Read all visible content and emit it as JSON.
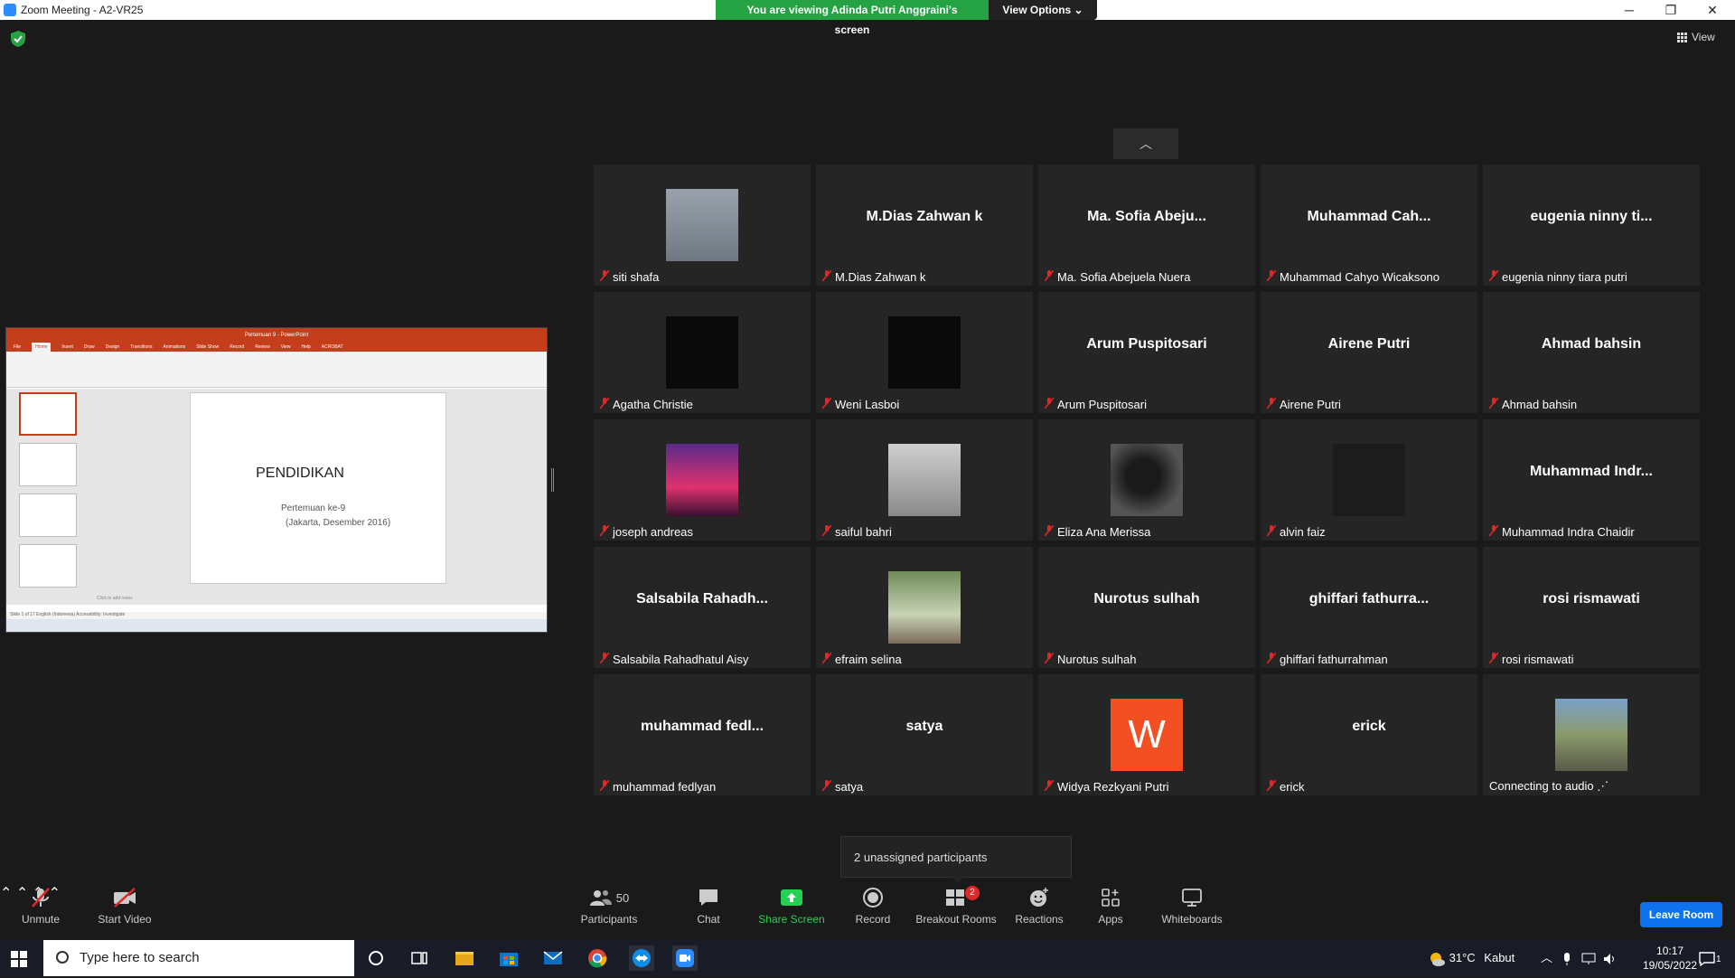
{
  "window": {
    "title": "Zoom Meeting - A2-VR25",
    "minimize": "─",
    "maximize": "❐",
    "close": "✕"
  },
  "banner": {
    "viewing": "You are viewing Adinda Putri Anggraini's screen",
    "view_options": "View Options ⌄"
  },
  "view_button": "View",
  "shared_screen": {
    "app_title": "Pertemuan 9 - PowerPoint",
    "tabs": [
      "File",
      "Home",
      "Insert",
      "Draw",
      "Design",
      "Transitions",
      "Animations",
      "Slide Show",
      "Record",
      "Review",
      "View",
      "Help",
      "ACROBAT"
    ],
    "slide_title": "PENDIDIKAN",
    "slide_line1": "Pertemuan ke-9",
    "slide_line2": "(Jakarta, Desember 2016)",
    "notes": "Click to add notes",
    "status": "Slide 1 of 17   English (Indonesia)   Accessibility: Investigate"
  },
  "participants_grid": [
    {
      "big": "",
      "name": "siti shafa",
      "video": "grey"
    },
    {
      "big": "M.Dias Zahwan k",
      "name": "M.Dias Zahwan k",
      "video": ""
    },
    {
      "big": "Ma. Sofia Abeju...",
      "name": "Ma. Sofia Abejuela Nuera",
      "video": ""
    },
    {
      "big": "Muhammad Cah...",
      "name": "Muhammad Cahyo Wicaksono",
      "video": ""
    },
    {
      "big": "eugenia ninny ti...",
      "name": "eugenia ninny tiara putri",
      "video": ""
    },
    {
      "big": "",
      "name": "Agatha Christie",
      "video": "black"
    },
    {
      "big": "",
      "name": "Weni Lasboi",
      "video": "black"
    },
    {
      "big": "Arum Puspitosari",
      "name": "Arum Puspitosari",
      "video": ""
    },
    {
      "big": "Airene Putri",
      "name": "Airene Putri",
      "video": ""
    },
    {
      "big": "Ahmad bahsin",
      "name": "Ahmad bahsin",
      "video": ""
    },
    {
      "big": "",
      "name": "joseph andreas",
      "video": "sunset"
    },
    {
      "big": "",
      "name": "saiful bahri",
      "video": "person"
    },
    {
      "big": "",
      "name": "Eliza Ana Merissa",
      "video": "silhouette"
    },
    {
      "big": "",
      "name": "alvin faiz",
      "video": "dark"
    },
    {
      "big": "Muhammad Indr...",
      "name": "Muhammad Indra Chaidir",
      "video": ""
    },
    {
      "big": "Salsabila Rahadh...",
      "name": "Salsabila Rahadhatul Aisy",
      "video": ""
    },
    {
      "big": "",
      "name": "efraim selina",
      "video": "plants"
    },
    {
      "big": "Nurotus sulhah",
      "name": "Nurotus sulhah",
      "video": ""
    },
    {
      "big": "ghiffari fathurra...",
      "name": "ghiffari fathurrahman",
      "video": ""
    },
    {
      "big": "rosi rismawati",
      "name": "rosi rismawati",
      "video": ""
    },
    {
      "big": "muhammad fedl...",
      "name": "muhammad fedlyan",
      "video": ""
    },
    {
      "big": "satya",
      "name": "satya",
      "video": ""
    },
    {
      "big": "",
      "name": "Widya Rezkyani Putri",
      "video": "letter",
      "letter": "W"
    },
    {
      "big": "erick",
      "name": "erick",
      "video": ""
    },
    {
      "big": "",
      "name": "Connecting to audio ⋰",
      "video": "bike",
      "no_mic": true
    }
  ],
  "popup": "2 unassigned participants",
  "toolbar": {
    "unmute": "Unmute",
    "start_video": "Start Video",
    "participants": "Participants",
    "participants_count": "50",
    "chat": "Chat",
    "share_screen": "Share Screen",
    "record": "Record",
    "breakout_rooms": "Breakout Rooms",
    "breakout_badge": "2",
    "reactions": "Reactions",
    "apps": "Apps",
    "whiteboards": "Whiteboards",
    "leave": "Leave Room"
  },
  "taskbar": {
    "search_placeholder": "Type here to search",
    "temperature": "31°C",
    "weather": "Kabut",
    "time": "10:17",
    "date": "19/05/2022",
    "notification_count": "1"
  },
  "colors": {
    "banner_green": "#25a244",
    "leave_blue": "#0e72ed",
    "share_screen_green": "#24d153",
    "mute_red": "#e02828",
    "ppt_red": "#c43e1c"
  }
}
